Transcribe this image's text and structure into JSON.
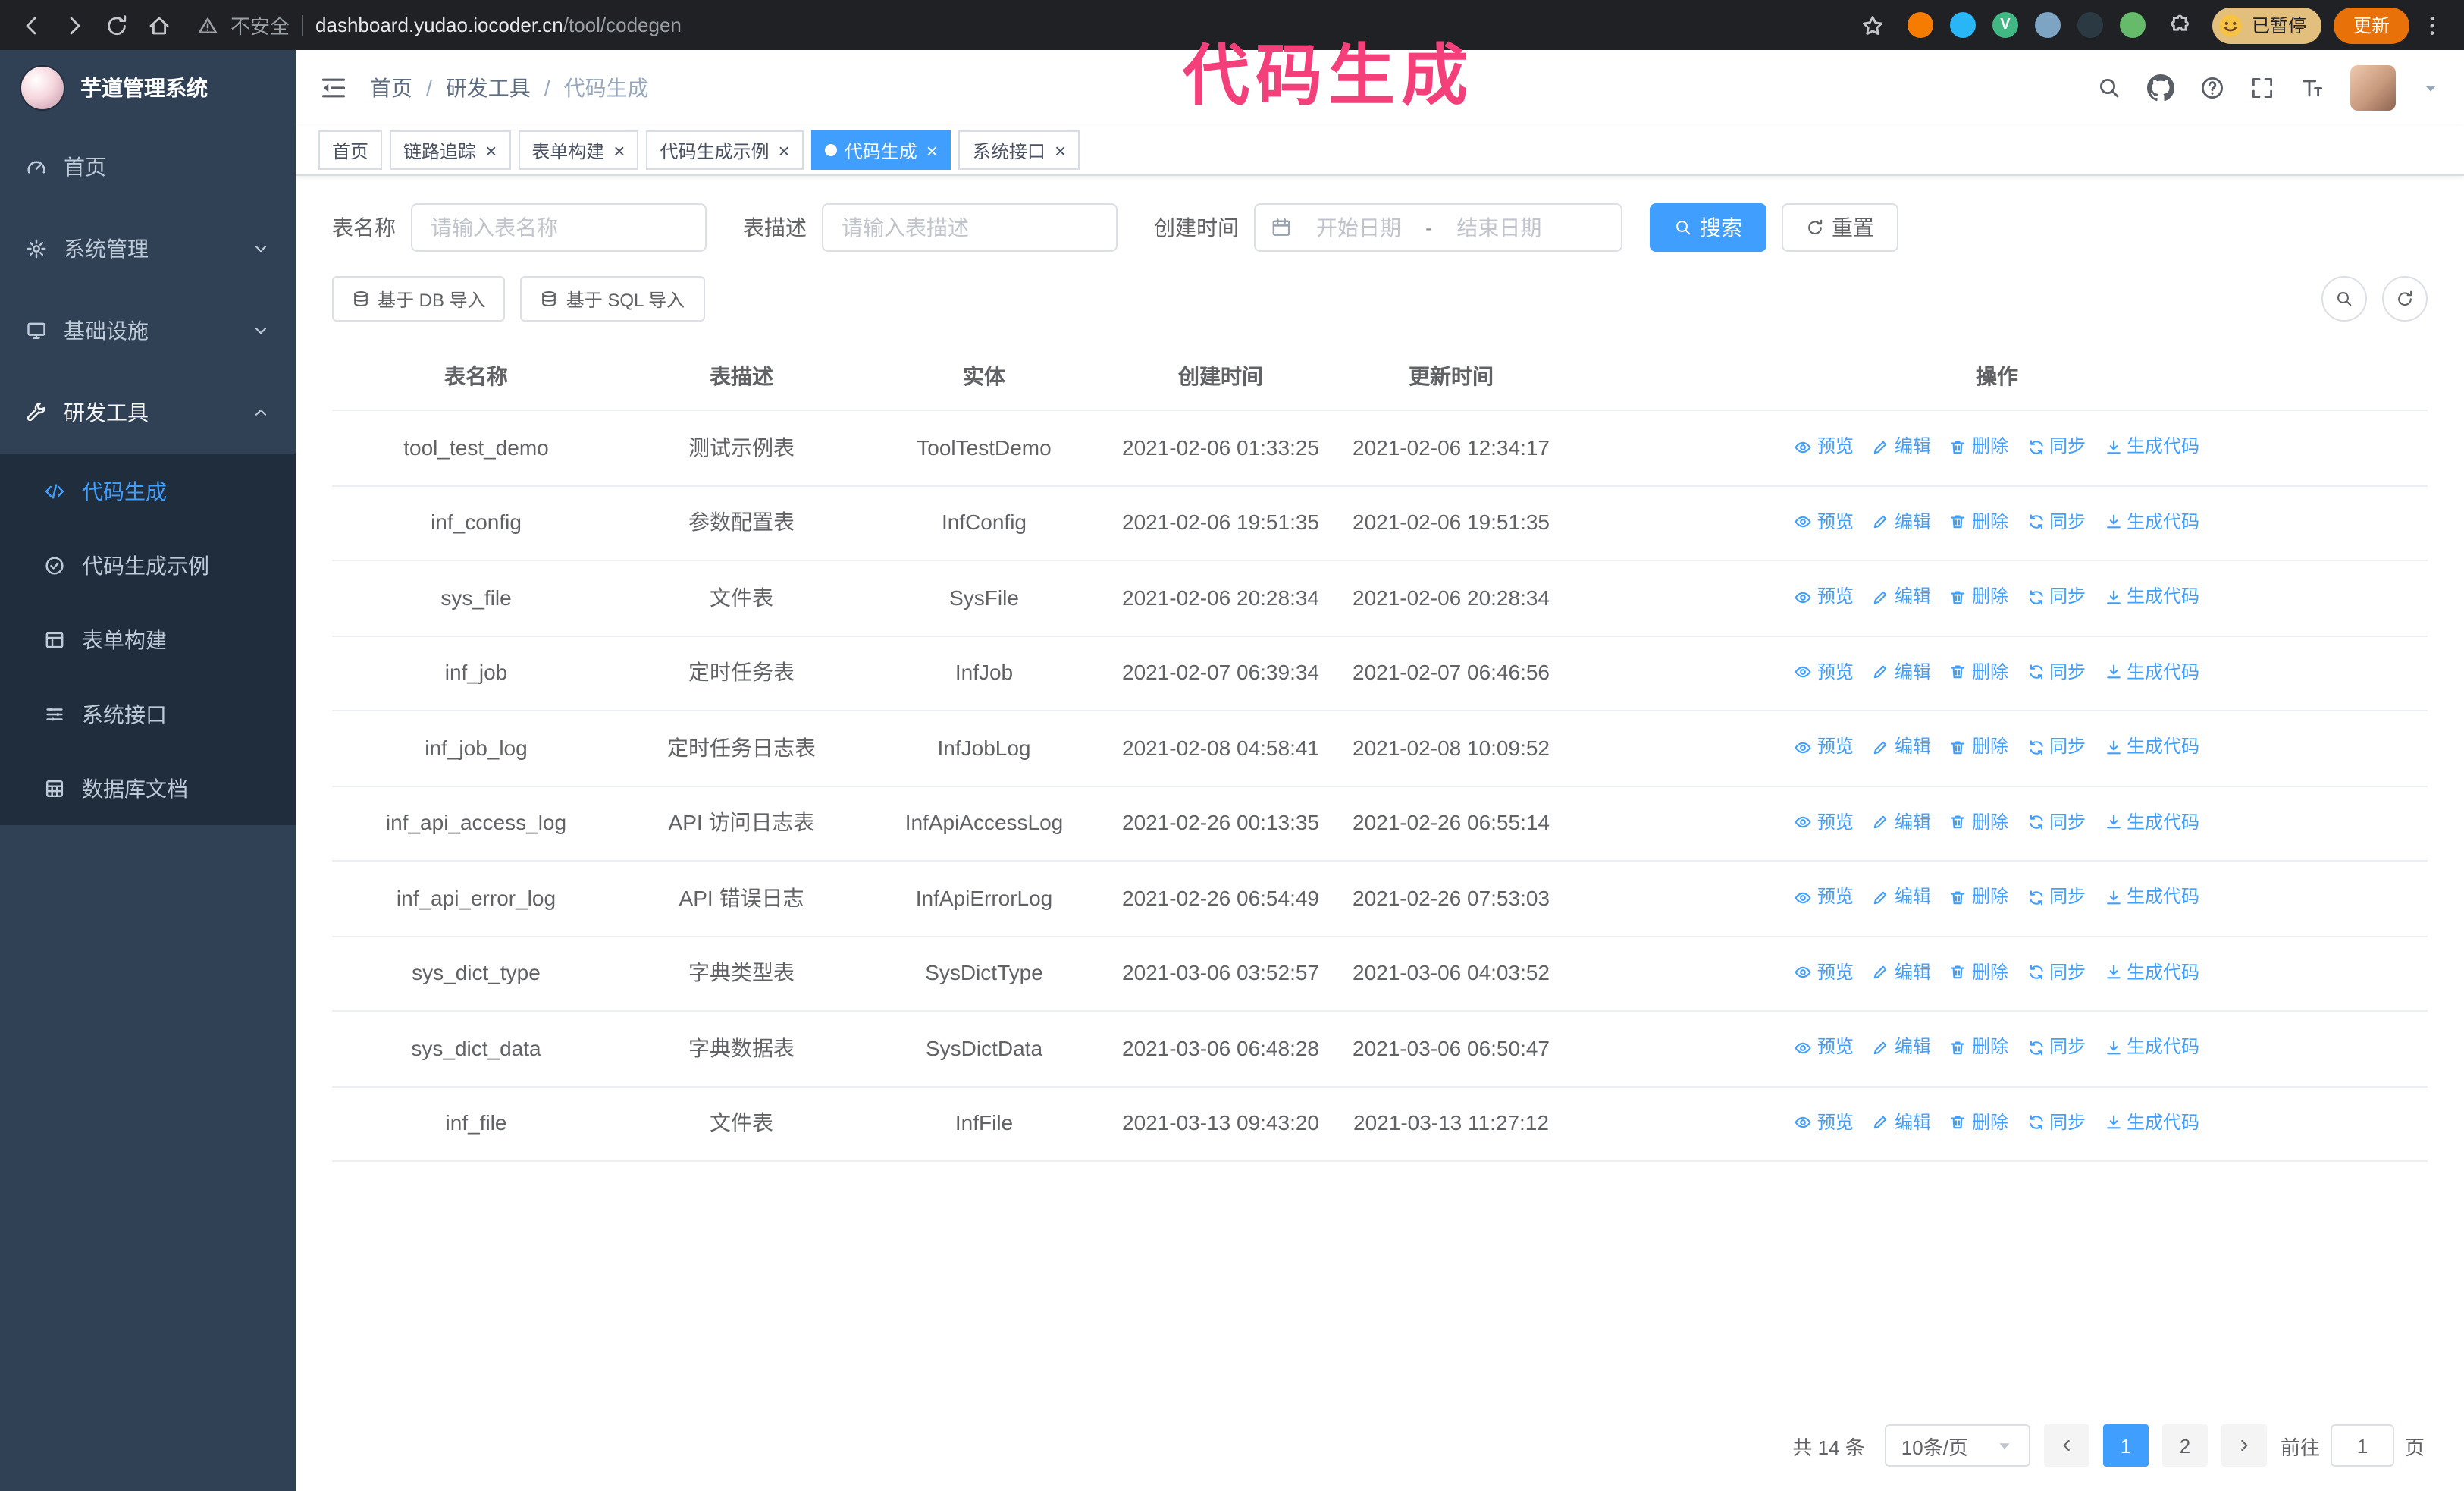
{
  "annotation": "代码生成",
  "browser": {
    "security_label": "不安全",
    "url_host": "dashboard.yudao.iocoder.cn",
    "url_path": "/tool/codegen",
    "paused_badge": "已暂停",
    "update_button": "更新",
    "extensions": [
      {
        "color": "#f57c00"
      },
      {
        "color": "#29b6f6"
      },
      {
        "color": "#41b883",
        "letter": "V"
      },
      {
        "color": "#7da4c3"
      },
      {
        "color": "#2b3a42"
      },
      {
        "color": "#66bb6a"
      }
    ]
  },
  "sidebar": {
    "logo_title": "芋道管理系统",
    "items": [
      {
        "id": "home",
        "label": "首页",
        "icon": "gauge-icon"
      },
      {
        "id": "system-manage",
        "label": "系统管理",
        "icon": "gear-icon",
        "expandable": true
      },
      {
        "id": "infrastructure",
        "label": "基础设施",
        "icon": "monitor-icon",
        "expandable": true
      },
      {
        "id": "dev-tools",
        "label": "研发工具",
        "icon": "wrench-icon",
        "expandable": true,
        "expanded": true,
        "children": [
          {
            "id": "codegen",
            "label": "代码生成",
            "icon": "code-icon",
            "active": true
          },
          {
            "id": "codegen-example",
            "label": "代码生成示例",
            "icon": "check-circle-icon"
          },
          {
            "id": "form-builder",
            "label": "表单构建",
            "icon": "form-icon"
          },
          {
            "id": "system-api",
            "label": "系统接口",
            "icon": "api-icon"
          },
          {
            "id": "db-doc",
            "label": "数据库文档",
            "icon": "table-grid-icon"
          }
        ]
      }
    ]
  },
  "header": {
    "breadcrumb": [
      "首页",
      "研发工具",
      "代码生成"
    ],
    "separator": "/"
  },
  "tabs": [
    {
      "label": "首页"
    },
    {
      "label": "链路追踪",
      "closable": true
    },
    {
      "label": "表单构建",
      "closable": true
    },
    {
      "label": "代码生成示例",
      "closable": true
    },
    {
      "label": "代码生成",
      "closable": true,
      "active": true
    },
    {
      "label": "系统接口",
      "closable": true
    }
  ],
  "filters": {
    "name_label": "表名称",
    "name_placeholder": "请输入表名称",
    "desc_label": "表描述",
    "desc_placeholder": "请输入表描述",
    "time_label": "创建时间",
    "start_placeholder": "开始日期",
    "range_separator": "-",
    "end_placeholder": "结束日期",
    "search_button": "搜索",
    "reset_button": "重置"
  },
  "toolbar": {
    "import_db": "基于 DB 导入",
    "import_sql": "基于 SQL 导入"
  },
  "table": {
    "columns": [
      "表名称",
      "表描述",
      "实体",
      "创建时间",
      "更新时间",
      "操作"
    ],
    "actions": [
      {
        "id": "preview",
        "label": "预览",
        "icon": "eye-icon"
      },
      {
        "id": "edit",
        "label": "编辑",
        "icon": "edit-icon"
      },
      {
        "id": "delete",
        "label": "删除",
        "icon": "delete-icon"
      },
      {
        "id": "sync",
        "label": "同步",
        "icon": "sync-icon"
      },
      {
        "id": "generate",
        "label": "生成代码",
        "icon": "download-icon"
      }
    ],
    "rows": [
      {
        "name": "tool_test_demo",
        "desc": "测试示例表",
        "entity": "ToolTestDemo",
        "created": "2021-02-06 01:33:25",
        "updated": "2021-02-06 12:34:17"
      },
      {
        "name": "inf_config",
        "desc": "参数配置表",
        "entity": "InfConfig",
        "created": "2021-02-06 19:51:35",
        "updated": "2021-02-06 19:51:35"
      },
      {
        "name": "sys_file",
        "desc": "文件表",
        "entity": "SysFile",
        "created": "2021-02-06 20:28:34",
        "updated": "2021-02-06 20:28:34"
      },
      {
        "name": "inf_job",
        "desc": "定时任务表",
        "entity": "InfJob",
        "created": "2021-02-07 06:39:34",
        "updated": "2021-02-07 06:46:56"
      },
      {
        "name": "inf_job_log",
        "desc": "定时任务日志表",
        "entity": "InfJobLog",
        "created": "2021-02-08 04:58:41",
        "updated": "2021-02-08 10:09:52"
      },
      {
        "name": "inf_api_access_log",
        "desc": "API 访问日志表",
        "entity": "InfApiAccessLog",
        "created": "2021-02-26 00:13:35",
        "updated": "2021-02-26 06:55:14"
      },
      {
        "name": "inf_api_error_log",
        "desc": "API 错误日志",
        "entity": "InfApiErrorLog",
        "created": "2021-02-26 06:54:49",
        "updated": "2021-02-26 07:53:03"
      },
      {
        "name": "sys_dict_type",
        "desc": "字典类型表",
        "entity": "SysDictType",
        "created": "2021-03-06 03:52:57",
        "updated": "2021-03-06 04:03:52"
      },
      {
        "name": "sys_dict_data",
        "desc": "字典数据表",
        "entity": "SysDictData",
        "created": "2021-03-06 06:48:28",
        "updated": "2021-03-06 06:50:47"
      },
      {
        "name": "inf_file",
        "desc": "文件表",
        "entity": "InfFile",
        "created": "2021-03-13 09:43:20",
        "updated": "2021-03-13 11:27:12"
      }
    ]
  },
  "pagination": {
    "total_text": "共 14 条",
    "page_size": "10条/页",
    "pages": [
      "1",
      "2"
    ],
    "active_page": "1",
    "goto_label": "前往",
    "goto_value": "1",
    "page_suffix": "页"
  }
}
